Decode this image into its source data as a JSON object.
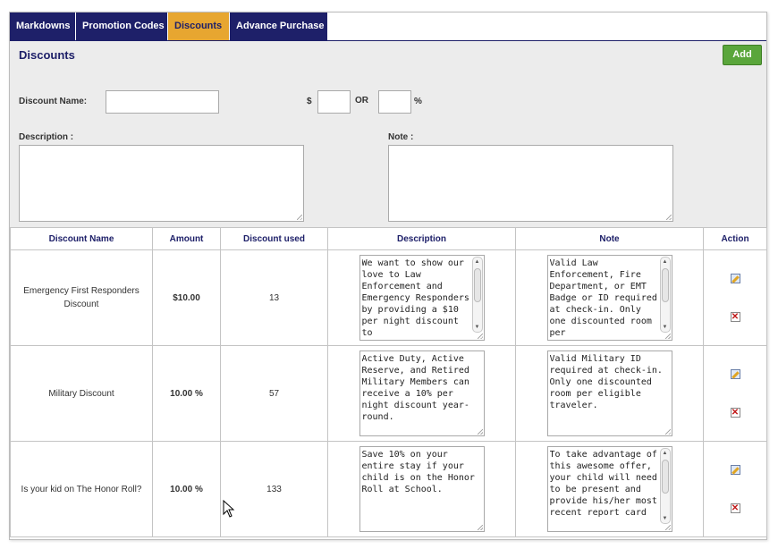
{
  "tabs": [
    {
      "label": "Markdowns",
      "active": false
    },
    {
      "label": "Promotion Codes",
      "active": false
    },
    {
      "label": "Discounts",
      "active": true
    },
    {
      "label": "Advance Purchase",
      "active": false
    }
  ],
  "section": {
    "title": "Discounts",
    "add_label": "Add"
  },
  "form": {
    "discount_name_label": "Discount Name:",
    "discount_name_value": "",
    "dollar_symbol": "$",
    "or_label": "OR",
    "percent_symbol": "%",
    "dollar_value": "",
    "percent_value": "",
    "description_label": "Description :",
    "description_value": "",
    "note_label": "Note :",
    "note_value": ""
  },
  "table": {
    "headers": [
      "Discount Name",
      "Amount",
      "Discount used",
      "Description",
      "Note",
      "Action"
    ],
    "rows": [
      {
        "name": "Emergency First Responders Discount",
        "amount": "$10.00",
        "used": "13",
        "description": "We want to show our love to Law Enforcement and Emergency Responders by providing a $10 per night discount to",
        "note": "Valid Law Enforcement, Fire Department, or EMT Badge or ID required at check-in. Only one discounted room per"
      },
      {
        "name": "Military Discount",
        "amount": "10.00 %",
        "used": "57",
        "description": "Active Duty, Active Reserve, and Retired Military Members can receive a 10% per night discount year-round.",
        "note": "Valid Military ID required at check-in. Only one discounted room per eligible traveler."
      },
      {
        "name": "Is your kid on The Honor Roll?",
        "amount": "10.00 %",
        "used": "133",
        "description": "Save 10% on your entire stay if your child is on the Honor Roll at School.",
        "note": "To take advantage of this awesome offer, your child will need to be present and provide his/her most recent report card"
      }
    ]
  },
  "icons": {
    "edit": "edit-icon",
    "delete": "delete-icon"
  },
  "colors": {
    "tab_bg": "#1e2069",
    "tab_active_bg": "#e7a630",
    "add_button": "#5aa63b",
    "header_text": "#1e2069",
    "form_bg": "#ececec"
  }
}
